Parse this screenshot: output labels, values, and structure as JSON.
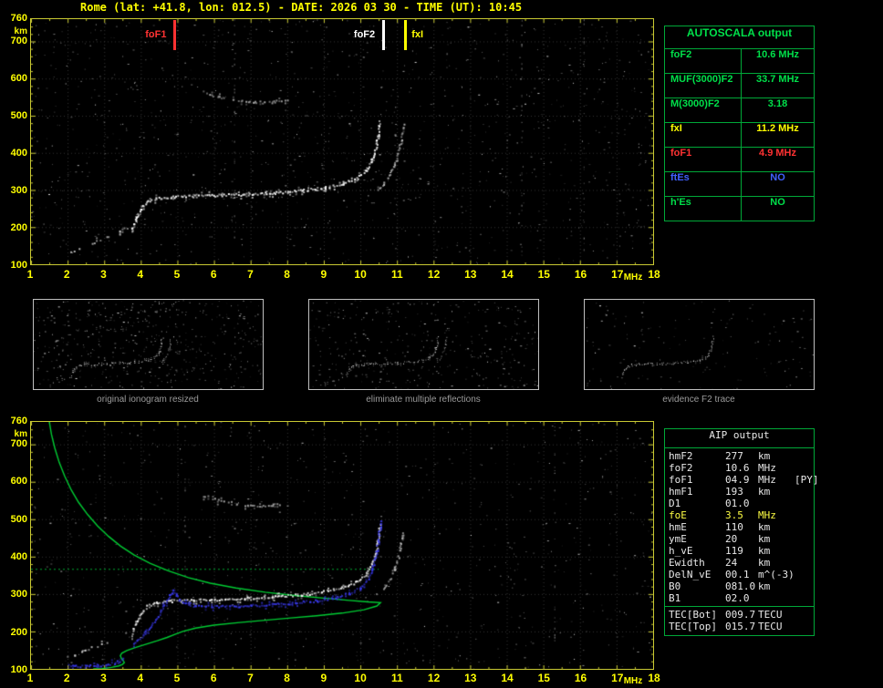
{
  "window": {
    "title": "Rome (lat: +41.8, lon: 012.5) - DATE: 2026 03 30 - TIME (UT): 10:45"
  },
  "colors": {
    "axis_label": "#ffff00",
    "plot_border": "#c8c832",
    "grid": "#343434",
    "green": "#00e04a",
    "panel_border": "#00a838",
    "red": "#ff3232",
    "blue": "#4040ff",
    "white": "#ffffff",
    "yellow": "#ffff00",
    "caption_gray": "#9a9a9a"
  },
  "axes": {
    "x_ticks": [
      "1",
      "2",
      "3",
      "4",
      "5",
      "6",
      "7",
      "8",
      "9",
      "10",
      "11",
      "12",
      "13",
      "14",
      "15",
      "16",
      "17",
      "18"
    ],
    "x_unit": "MHz",
    "y_ticks": [
      "760",
      "700",
      "600",
      "500",
      "400",
      "300",
      "200",
      "100"
    ],
    "y_unit": "km",
    "x_range": [
      1,
      18
    ],
    "y_range": [
      100,
      760
    ]
  },
  "markers": [
    {
      "name": "foF1",
      "label": "foF1",
      "mhz": 4.9,
      "color": "#ff3232",
      "side": "left"
    },
    {
      "name": "foF2",
      "label": "foF2",
      "mhz": 10.6,
      "color": "#ffffff",
      "side": "left"
    },
    {
      "name": "fxI",
      "label": "fxI",
      "mhz": 11.2,
      "color": "#ffff00",
      "side": "right"
    }
  ],
  "autoscala": {
    "header": "AUTOSCALA output",
    "rows": [
      {
        "label": "foF2",
        "value": "10.6 MHz",
        "color": "#00e04a"
      },
      {
        "label": "MUF(3000)F2",
        "value": "33.7 MHz",
        "color": "#00e04a"
      },
      {
        "label": "M(3000)F2",
        "value": "3.18",
        "color": "#00e04a"
      },
      {
        "label": "fxI",
        "value": "11.2 MHz",
        "color": "#ffff00"
      },
      {
        "label": "foF1",
        "value": "4.9 MHz",
        "color": "#ff3232"
      },
      {
        "label": "ftEs",
        "value": "NO",
        "color": "#4060ff"
      },
      {
        "label": "h'Es",
        "value": "NO",
        "color": "#00e04a"
      }
    ]
  },
  "thumbnails": [
    {
      "caption": "original ionogram resized"
    },
    {
      "caption": "eliminate multiple reflections"
    },
    {
      "caption": "evidence F2 trace"
    }
  ],
  "aip": {
    "header": "AIP output",
    "rows": [
      {
        "name": "hmF2",
        "value": "277",
        "unit": "km",
        "extra": "",
        "color": "#e8e8e8"
      },
      {
        "name": "foF2",
        "value": "10.6",
        "unit": "MHz",
        "extra": "",
        "color": "#e8e8e8"
      },
      {
        "name": "foF1",
        "value": "04.9",
        "unit": "MHz",
        "extra": "[PY]",
        "color": "#e8e8e8"
      },
      {
        "name": "hmF1",
        "value": "193",
        "unit": "km",
        "extra": "",
        "color": "#e8e8e8"
      },
      {
        "name": "D1",
        "value": "01.0",
        "unit": "",
        "extra": "",
        "color": "#e8e8e8"
      },
      {
        "name": "foE",
        "value": "3.5",
        "unit": "MHz",
        "extra": "",
        "color": "#ffff44"
      },
      {
        "name": "hmE",
        "value": "110",
        "unit": "km",
        "extra": "",
        "color": "#e8e8e8"
      },
      {
        "name": "ymE",
        "value": "20",
        "unit": "km",
        "extra": "",
        "color": "#e8e8e8"
      },
      {
        "name": "h_vE",
        "value": "119",
        "unit": "km",
        "extra": "",
        "color": "#e8e8e8"
      },
      {
        "name": "Ewidth",
        "value": "24",
        "unit": "km",
        "extra": "",
        "color": "#e8e8e8"
      },
      {
        "name": "DelN_vE",
        "value": "00.1",
        "unit": "m^(-3)",
        "extra": "",
        "color": "#e8e8e8"
      },
      {
        "name": "B0",
        "value": "081.0",
        "unit": "km",
        "extra": "",
        "color": "#e8e8e8"
      },
      {
        "name": "B1",
        "value": "02.0",
        "unit": "",
        "extra": "",
        "color": "#e8e8e8"
      }
    ],
    "tec_rows": [
      {
        "name": "TEC[Bot]",
        "value": "009.7",
        "unit": "TECU",
        "extra": "",
        "color": "#e8e8e8"
      },
      {
        "name": "TEC[Top]",
        "value": "015.7",
        "unit": "TECU",
        "extra": "",
        "color": "#e8e8e8"
      }
    ]
  },
  "chart_data": {
    "type": "scatter",
    "title": "Rome ionogram 2026-03-30 10:45 UT",
    "xlabel": "MHz",
    "ylabel": "km",
    "x_range": [
      1,
      18
    ],
    "y_range": [
      100,
      760
    ],
    "grid": true,
    "trace_defs": {
      "omode": {
        "color": "#ffffff",
        "style": "dots",
        "size": 2,
        "points": [
          [
            3.72,
            192
          ],
          [
            3.85,
            222
          ],
          [
            4.0,
            252
          ],
          [
            4.15,
            270
          ],
          [
            4.4,
            279
          ],
          [
            4.8,
            283
          ],
          [
            5.4,
            285
          ],
          [
            6.0,
            287
          ],
          [
            6.8,
            290
          ],
          [
            7.6,
            294
          ],
          [
            8.4,
            300
          ],
          [
            9.0,
            308
          ],
          [
            9.5,
            319
          ],
          [
            9.9,
            334
          ],
          [
            10.15,
            355
          ],
          [
            10.3,
            380
          ],
          [
            10.4,
            412
          ],
          [
            10.47,
            448
          ],
          [
            10.52,
            488
          ]
        ]
      },
      "xmode": {
        "color": "#bbbbbb",
        "style": "dots",
        "size": 2,
        "sparse": 0.8,
        "points": [
          [
            10.45,
            302
          ],
          [
            10.62,
            318
          ],
          [
            10.78,
            340
          ],
          [
            10.92,
            368
          ],
          [
            11.02,
            400
          ],
          [
            11.1,
            438
          ],
          [
            11.16,
            478
          ]
        ]
      },
      "secondhop": {
        "color": "#aaaaaa",
        "style": "dots",
        "size": 2,
        "sparse": 0.55,
        "points": [
          [
            5.7,
            565
          ],
          [
            6.1,
            552
          ],
          [
            6.6,
            542
          ],
          [
            7.1,
            537
          ],
          [
            7.6,
            539
          ],
          [
            8.0,
            546
          ]
        ]
      },
      "lowband": {
        "color": "#cccccc",
        "style": "dots",
        "size": 2,
        "sparse": 0.35,
        "points": [
          [
            1.9,
            128
          ],
          [
            2.2,
            140
          ],
          [
            2.5,
            152
          ],
          [
            2.8,
            163
          ],
          [
            3.1,
            176
          ],
          [
            3.4,
            190
          ],
          [
            3.6,
            200
          ]
        ]
      },
      "blue_restored": {
        "color": "#3a3aee",
        "style": "dots",
        "size": 2,
        "segments": [
          [
            [
              2.0,
              112
            ],
            [
              2.2,
              110
            ],
            [
              2.5,
              109
            ],
            [
              2.8,
              110
            ],
            [
              3.1,
              114
            ],
            [
              3.35,
              120
            ],
            [
              3.5,
              128
            ]
          ],
          [
            [
              3.8,
              170
            ],
            [
              4.05,
              192
            ],
            [
              4.25,
              215
            ],
            [
              4.45,
              242
            ],
            [
              4.6,
              266
            ],
            [
              4.72,
              288
            ],
            [
              4.82,
              303
            ],
            [
              4.88,
              310
            ],
            [
              4.95,
              298
            ],
            [
              5.05,
              286
            ],
            [
              5.2,
              278
            ],
            [
              5.5,
              272
            ],
            [
              5.9,
              269
            ],
            [
              6.4,
              269
            ],
            [
              7.0,
              271
            ],
            [
              7.6,
              274
            ],
            [
              8.2,
              278
            ],
            [
              8.8,
              284
            ],
            [
              9.3,
              292
            ],
            [
              9.7,
              304
            ],
            [
              10.0,
              320
            ],
            [
              10.2,
              342
            ],
            [
              10.33,
              372
            ],
            [
              10.42,
              408
            ],
            [
              10.49,
              450
            ],
            [
              10.53,
              495
            ]
          ]
        ]
      },
      "green_profile": {
        "color": "#00cc33",
        "style": "line",
        "width": 1.4,
        "points": [
          [
            1.5,
            760
          ],
          [
            1.56,
            726
          ],
          [
            1.65,
            690
          ],
          [
            1.77,
            652
          ],
          [
            1.92,
            615
          ],
          [
            2.1,
            578
          ],
          [
            2.3,
            545
          ],
          [
            2.55,
            512
          ],
          [
            2.82,
            482
          ],
          [
            3.12,
            454
          ],
          [
            3.45,
            428
          ],
          [
            3.82,
            404
          ],
          [
            4.25,
            382
          ],
          [
            4.75,
            362
          ],
          [
            5.3,
            344
          ],
          [
            5.9,
            329
          ],
          [
            6.6,
            316
          ],
          [
            7.4,
            305
          ],
          [
            8.2,
            296
          ],
          [
            9.0,
            289
          ],
          [
            9.7,
            283
          ],
          [
            10.2,
            279
          ],
          [
            10.55,
            277
          ],
          [
            10.45,
            268
          ],
          [
            10.1,
            258
          ],
          [
            9.5,
            249
          ],
          [
            8.8,
            242
          ],
          [
            8.1,
            236
          ],
          [
            7.4,
            230
          ],
          [
            6.7,
            224
          ],
          [
            6.0,
            217
          ],
          [
            5.5,
            209
          ],
          [
            5.15,
            200
          ],
          [
            4.95,
            193
          ],
          [
            4.72,
            184
          ],
          [
            4.45,
            175
          ],
          [
            4.15,
            166
          ],
          [
            3.85,
            157
          ],
          [
            3.62,
            149
          ],
          [
            3.48,
            142
          ],
          [
            3.44,
            135
          ],
          [
            3.47,
            128
          ],
          [
            3.52,
            122
          ],
          [
            3.55,
            117
          ],
          [
            3.5,
            112
          ],
          [
            3.4,
            108
          ],
          [
            3.2,
            104
          ],
          [
            2.95,
            101
          ],
          [
            2.7,
            100
          ]
        ]
      },
      "green_dotted": {
        "color": "#00aa33",
        "style": "dashed",
        "width": 1,
        "points": [
          [
            1.0,
            366
          ],
          [
            10.5,
            366
          ]
        ]
      }
    },
    "plots": [
      {
        "canvas": "top-canvas",
        "grid": true,
        "seed": 7,
        "noise": 1150,
        "streaks": [
          6.55,
          14.4,
          16.1
        ],
        "traces": [
          "lowband",
          "omode",
          "xmode",
          "secondhop"
        ]
      },
      {
        "canvas": "bottom-canvas",
        "grid": true,
        "seed": 13,
        "noise": 800,
        "streaks": [
          5.2,
          15.3
        ],
        "traces": [
          "green_dotted",
          "green_profile",
          "lowband",
          "omode",
          "xmode",
          "secondhop",
          "blue_restored"
        ]
      },
      {
        "canvas": "thumb-canvas-0",
        "grid": false,
        "seed": 21,
        "noise": 520,
        "streaks": [],
        "dot_size": 1,
        "traces": [
          "lowband",
          "omode",
          "xmode",
          "secondhop"
        ]
      },
      {
        "canvas": "thumb-canvas-1",
        "grid": false,
        "seed": 22,
        "noise": 380,
        "streaks": [],
        "dot_size": 1,
        "traces": [
          "lowband",
          "omode",
          "xmode"
        ]
      },
      {
        "canvas": "thumb-canvas-2",
        "grid": false,
        "seed": 23,
        "noise": 150,
        "streaks": [],
        "dot_size": 1,
        "traces": [
          "omode"
        ]
      }
    ]
  }
}
